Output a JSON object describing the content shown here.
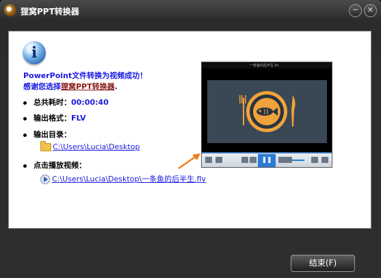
{
  "window": {
    "title": "狸窝PPT转换器",
    "minimize_glyph": "─",
    "close_glyph": "✕"
  },
  "message": {
    "line1": "PowerPoint文件转换为视频成功！",
    "line2_prefix": "感谢您选择",
    "line2_link": "狸窝PPT转换器",
    "line2_suffix": "."
  },
  "details": {
    "elapsed_label": "总共耗时：",
    "elapsed_value": "00:00:40",
    "format_label": "输出格式：",
    "format_value": "FLV",
    "output_dir_label": "输出目录：",
    "output_dir_path": "C:\\Users\\Lucia\\Desktop",
    "play_label": "点击播放视频：",
    "video_path": "C:\\Users\\Lucia\\Desktop\\一条鱼的后半生.flv"
  },
  "player_preview": {
    "title": "一条鱼的后半生.flv",
    "pause_glyph": "❚❚",
    "colors": {
      "stage": "#3a4754",
      "plate": "#f0a33a",
      "accent": "#2b7bd6"
    }
  },
  "footer": {
    "finish_label": "结束(F)"
  },
  "colors": {
    "text_blue": "#1a1ae0",
    "link_dark_red": "#8b1a1a",
    "arrow_orange": "#f07c1c"
  }
}
